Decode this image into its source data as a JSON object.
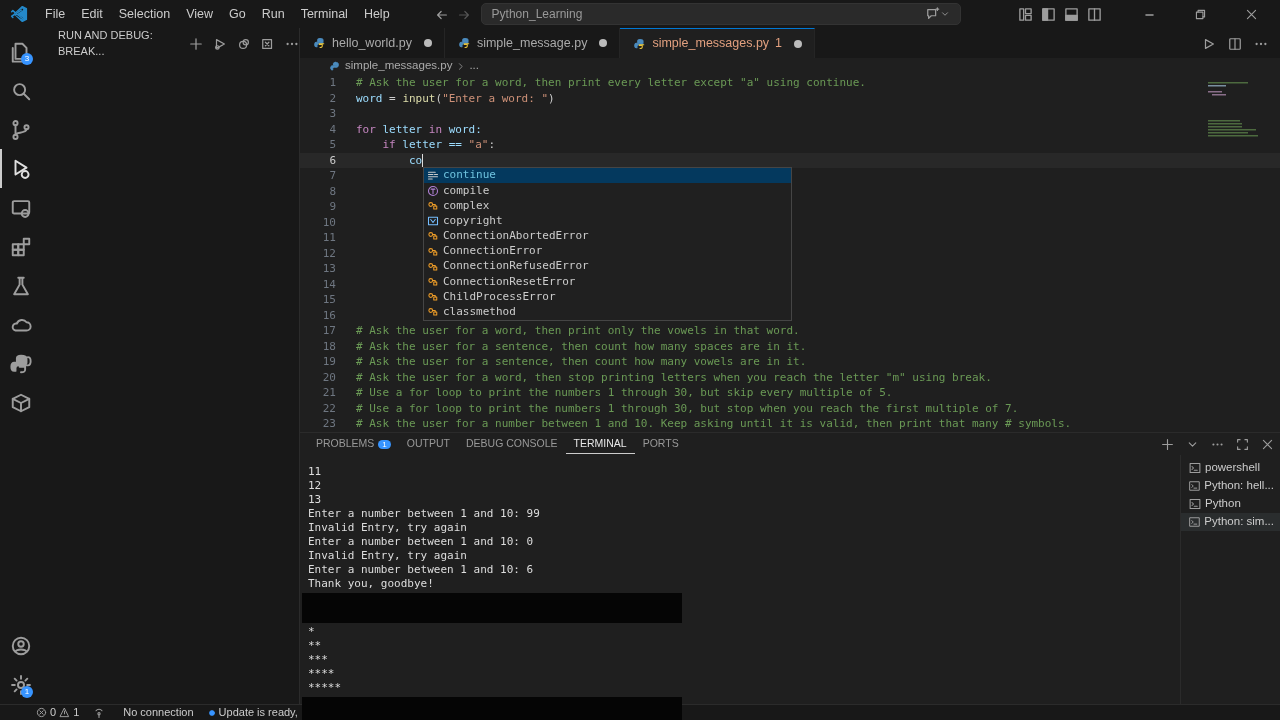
{
  "menu": [
    "File",
    "Edit",
    "Selection",
    "View",
    "Go",
    "Run",
    "Terminal",
    "Help"
  ],
  "command_center": {
    "text": "Python_Learning"
  },
  "activity_bar": [
    {
      "selected": false,
      "badge": "3"
    },
    {
      "selected": false
    },
    {
      "selected": false
    },
    {
      "selected": true
    },
    {
      "selected": false
    },
    {
      "selected": false
    },
    {
      "selected": false
    },
    {
      "selected": false
    },
    {
      "selected": false
    },
    {
      "selected": false
    }
  ],
  "activity_bottom": [
    {
      "selected": false
    },
    {
      "selected": false,
      "badge": "1"
    }
  ],
  "sidebar": {
    "title": "RUN AND DEBUG: BREAK..."
  },
  "tabs": [
    {
      "label": "hello_world.py",
      "selected": false,
      "modified": true
    },
    {
      "label": "simple_message.py",
      "selected": false,
      "modified": true
    },
    {
      "label": "simple_messages.py",
      "problems": "1",
      "selected": true,
      "modified": true
    }
  ],
  "breadcrumb": [
    "simple_messages.py",
    "..."
  ],
  "code": [
    {
      "number": "1",
      "tokens": [
        {
          "text": "# Ask the user for a word, then print every letter except \"a\" using continue.",
          "kind": "comment"
        }
      ]
    },
    {
      "number": "2",
      "tokens": [
        {
          "text": "word",
          "kind": "var"
        },
        {
          "text": " = ",
          "kind": "plain"
        },
        {
          "text": "input",
          "kind": "func"
        },
        {
          "text": "(",
          "kind": "plain"
        },
        {
          "text": "\"Enter a word: \"",
          "kind": "string"
        },
        {
          "text": ")",
          "kind": "plain"
        }
      ]
    },
    {
      "number": "3"
    },
    {
      "number": "4",
      "tokens": [
        {
          "text": "for",
          "kind": "keyword"
        },
        {
          "text": " letter ",
          "kind": "var"
        },
        {
          "text": "in",
          "kind": "keyword"
        },
        {
          "text": " word:",
          "kind": "var"
        }
      ]
    },
    {
      "number": "5",
      "tokens": [
        {
          "text": "    if",
          "kind": "keyword"
        },
        {
          "text": " letter == ",
          "kind": "var"
        },
        {
          "text": "\"a\"",
          "kind": "string"
        },
        {
          "text": ":",
          "kind": "plain"
        }
      ]
    },
    {
      "number": "6",
      "current": true,
      "tokens": [
        {
          "text": "        co",
          "kind": "var"
        }
      ]
    },
    {
      "number": "7"
    },
    {
      "number": "8"
    },
    {
      "number": "9"
    },
    {
      "number": "10"
    },
    {
      "number": "11"
    },
    {
      "number": "12"
    },
    {
      "number": "13"
    },
    {
      "number": "14"
    },
    {
      "number": "15"
    },
    {
      "number": "16"
    },
    {
      "number": "17",
      "tokens": [
        {
          "text": "# Ask the user for a word, then print only the vowels in that word.",
          "kind": "comment"
        }
      ]
    },
    {
      "number": "18",
      "tokens": [
        {
          "text": "# Ask the user for a sentence, then count how many spaces are in it.",
          "kind": "comment"
        }
      ]
    },
    {
      "number": "19",
      "tokens": [
        {
          "text": "# Ask the user for a sentence, then count how many vowels are in it.",
          "kind": "comment"
        }
      ]
    },
    {
      "number": "20",
      "tokens": [
        {
          "text": "# Ask the user for a word, then stop printing letters when you reach the letter \"m\" using break.",
          "kind": "comment"
        }
      ]
    },
    {
      "number": "21",
      "tokens": [
        {
          "text": "# Use a for loop to print the numbers 1 through 30, but skip every multiple of 5.",
          "kind": "comment"
        }
      ]
    },
    {
      "number": "22",
      "tokens": [
        {
          "text": "# Use a for loop to print the numbers 1 through 30, but stop when you reach the first multiple of 7.",
          "kind": "comment"
        }
      ]
    },
    {
      "number": "23",
      "tokens": [
        {
          "text": "# Ask the user for a number between 1 and 10. Keep asking until it is valid, then print that many # symbols.",
          "kind": "comment"
        }
      ]
    }
  ],
  "suggestions": [
    {
      "label": "continue",
      "kind": "keyword",
      "selected": true
    },
    {
      "label": "compile",
      "kind": "function",
      "selected": false
    },
    {
      "label": "complex",
      "kind": "class",
      "selected": false
    },
    {
      "label": "copyright",
      "kind": "variable",
      "selected": false
    },
    {
      "label": "ConnectionAbortedError",
      "kind": "class",
      "selected": false
    },
    {
      "label": "ConnectionError",
      "kind": "class",
      "selected": false
    },
    {
      "label": "ConnectionRefusedError",
      "kind": "class",
      "selected": false
    },
    {
      "label": "ConnectionResetError",
      "kind": "class",
      "selected": false
    },
    {
      "label": "ChildProcessError",
      "kind": "class",
      "selected": false
    },
    {
      "label": "classmethod",
      "kind": "class",
      "selected": false
    }
  ],
  "panel_tabs": [
    {
      "label": "PROBLEMS",
      "badge": "1",
      "selected": false
    },
    {
      "label": "OUTPUT",
      "selected": false
    },
    {
      "label": "DEBUG CONSOLE",
      "selected": false
    },
    {
      "label": "TERMINAL",
      "selected": true
    },
    {
      "label": "PORTS",
      "selected": false
    }
  ],
  "terminal": [
    {
      "kind": "text",
      "text": "11"
    },
    {
      "kind": "text",
      "text": "12"
    },
    {
      "kind": "text",
      "text": "13"
    },
    {
      "kind": "text",
      "text": "Enter a number between 1 and 10: 99"
    },
    {
      "kind": "text",
      "text": "Invalid Entry, try again"
    },
    {
      "kind": "text",
      "text": "Enter a number between 1 and 10: 0"
    },
    {
      "kind": "text",
      "text": "Invalid Entry, try again"
    },
    {
      "kind": "text",
      "text": "Enter a number between 1 and 10: 6"
    },
    {
      "kind": "text",
      "text": "Thank you, goodbye!"
    },
    {
      "kind": "redacted"
    },
    {
      "kind": "text",
      "text": "*"
    },
    {
      "kind": "text",
      "text": "**"
    },
    {
      "kind": "text",
      "text": "***"
    },
    {
      "kind": "text",
      "text": "****"
    },
    {
      "kind": "text",
      "text": "*****"
    },
    {
      "kind": "redacted"
    }
  ],
  "terminal_list": [
    {
      "label": "powershell",
      "selected": false
    },
    {
      "label": "Python: hell...",
      "selected": false
    },
    {
      "label": "Python",
      "selected": false
    },
    {
      "label": "Python: sim...",
      "selected": true
    }
  ],
  "status_bar": {
    "errors": "0",
    "warnings": "1",
    "connection": "No connection",
    "update": "Update is ready,"
  }
}
